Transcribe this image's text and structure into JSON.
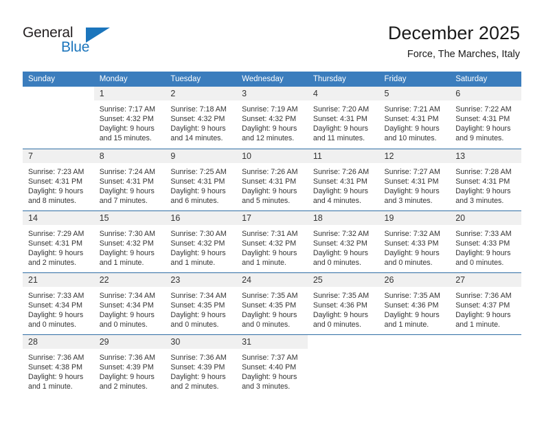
{
  "brand": {
    "line1": "General",
    "line2": "Blue",
    "triangle_color": "#1b75bc"
  },
  "header": {
    "month_title": "December 2025",
    "location": "Force, The Marches, Italy"
  },
  "theme": {
    "header_row_bg": "#3b7dbd",
    "row_divider": "#2e6da4",
    "daynum_band_bg": "#f0f0f0",
    "text": "#333333"
  },
  "calendar": {
    "weekday_headers": [
      "Sunday",
      "Monday",
      "Tuesday",
      "Wednesday",
      "Thursday",
      "Friday",
      "Saturday"
    ],
    "weeks": [
      [
        {
          "day": "",
          "blank": true,
          "lines": []
        },
        {
          "day": "1",
          "lines": [
            "Sunrise: 7:17 AM",
            "Sunset: 4:32 PM",
            "Daylight: 9 hours",
            "and 15 minutes."
          ]
        },
        {
          "day": "2",
          "lines": [
            "Sunrise: 7:18 AM",
            "Sunset: 4:32 PM",
            "Daylight: 9 hours",
            "and 14 minutes."
          ]
        },
        {
          "day": "3",
          "lines": [
            "Sunrise: 7:19 AM",
            "Sunset: 4:32 PM",
            "Daylight: 9 hours",
            "and 12 minutes."
          ]
        },
        {
          "day": "4",
          "lines": [
            "Sunrise: 7:20 AM",
            "Sunset: 4:31 PM",
            "Daylight: 9 hours",
            "and 11 minutes."
          ]
        },
        {
          "day": "5",
          "lines": [
            "Sunrise: 7:21 AM",
            "Sunset: 4:31 PM",
            "Daylight: 9 hours",
            "and 10 minutes."
          ]
        },
        {
          "day": "6",
          "lines": [
            "Sunrise: 7:22 AM",
            "Sunset: 4:31 PM",
            "Daylight: 9 hours",
            "and 9 minutes."
          ]
        }
      ],
      [
        {
          "day": "7",
          "lines": [
            "Sunrise: 7:23 AM",
            "Sunset: 4:31 PM",
            "Daylight: 9 hours",
            "and 8 minutes."
          ]
        },
        {
          "day": "8",
          "lines": [
            "Sunrise: 7:24 AM",
            "Sunset: 4:31 PM",
            "Daylight: 9 hours",
            "and 7 minutes."
          ]
        },
        {
          "day": "9",
          "lines": [
            "Sunrise: 7:25 AM",
            "Sunset: 4:31 PM",
            "Daylight: 9 hours",
            "and 6 minutes."
          ]
        },
        {
          "day": "10",
          "lines": [
            "Sunrise: 7:26 AM",
            "Sunset: 4:31 PM",
            "Daylight: 9 hours",
            "and 5 minutes."
          ]
        },
        {
          "day": "11",
          "lines": [
            "Sunrise: 7:26 AM",
            "Sunset: 4:31 PM",
            "Daylight: 9 hours",
            "and 4 minutes."
          ]
        },
        {
          "day": "12",
          "lines": [
            "Sunrise: 7:27 AM",
            "Sunset: 4:31 PM",
            "Daylight: 9 hours",
            "and 3 minutes."
          ]
        },
        {
          "day": "13",
          "lines": [
            "Sunrise: 7:28 AM",
            "Sunset: 4:31 PM",
            "Daylight: 9 hours",
            "and 3 minutes."
          ]
        }
      ],
      [
        {
          "day": "14",
          "lines": [
            "Sunrise: 7:29 AM",
            "Sunset: 4:31 PM",
            "Daylight: 9 hours",
            "and 2 minutes."
          ]
        },
        {
          "day": "15",
          "lines": [
            "Sunrise: 7:30 AM",
            "Sunset: 4:32 PM",
            "Daylight: 9 hours",
            "and 1 minute."
          ]
        },
        {
          "day": "16",
          "lines": [
            "Sunrise: 7:30 AM",
            "Sunset: 4:32 PM",
            "Daylight: 9 hours",
            "and 1 minute."
          ]
        },
        {
          "day": "17",
          "lines": [
            "Sunrise: 7:31 AM",
            "Sunset: 4:32 PM",
            "Daylight: 9 hours",
            "and 1 minute."
          ]
        },
        {
          "day": "18",
          "lines": [
            "Sunrise: 7:32 AM",
            "Sunset: 4:32 PM",
            "Daylight: 9 hours",
            "and 0 minutes."
          ]
        },
        {
          "day": "19",
          "lines": [
            "Sunrise: 7:32 AM",
            "Sunset: 4:33 PM",
            "Daylight: 9 hours",
            "and 0 minutes."
          ]
        },
        {
          "day": "20",
          "lines": [
            "Sunrise: 7:33 AM",
            "Sunset: 4:33 PM",
            "Daylight: 9 hours",
            "and 0 minutes."
          ]
        }
      ],
      [
        {
          "day": "21",
          "lines": [
            "Sunrise: 7:33 AM",
            "Sunset: 4:34 PM",
            "Daylight: 9 hours",
            "and 0 minutes."
          ]
        },
        {
          "day": "22",
          "lines": [
            "Sunrise: 7:34 AM",
            "Sunset: 4:34 PM",
            "Daylight: 9 hours",
            "and 0 minutes."
          ]
        },
        {
          "day": "23",
          "lines": [
            "Sunrise: 7:34 AM",
            "Sunset: 4:35 PM",
            "Daylight: 9 hours",
            "and 0 minutes."
          ]
        },
        {
          "day": "24",
          "lines": [
            "Sunrise: 7:35 AM",
            "Sunset: 4:35 PM",
            "Daylight: 9 hours",
            "and 0 minutes."
          ]
        },
        {
          "day": "25",
          "lines": [
            "Sunrise: 7:35 AM",
            "Sunset: 4:36 PM",
            "Daylight: 9 hours",
            "and 0 minutes."
          ]
        },
        {
          "day": "26",
          "lines": [
            "Sunrise: 7:35 AM",
            "Sunset: 4:36 PM",
            "Daylight: 9 hours",
            "and 1 minute."
          ]
        },
        {
          "day": "27",
          "lines": [
            "Sunrise: 7:36 AM",
            "Sunset: 4:37 PM",
            "Daylight: 9 hours",
            "and 1 minute."
          ]
        }
      ],
      [
        {
          "day": "28",
          "lines": [
            "Sunrise: 7:36 AM",
            "Sunset: 4:38 PM",
            "Daylight: 9 hours",
            "and 1 minute."
          ]
        },
        {
          "day": "29",
          "lines": [
            "Sunrise: 7:36 AM",
            "Sunset: 4:39 PM",
            "Daylight: 9 hours",
            "and 2 minutes."
          ]
        },
        {
          "day": "30",
          "lines": [
            "Sunrise: 7:36 AM",
            "Sunset: 4:39 PM",
            "Daylight: 9 hours",
            "and 2 minutes."
          ]
        },
        {
          "day": "31",
          "lines": [
            "Sunrise: 7:37 AM",
            "Sunset: 4:40 PM",
            "Daylight: 9 hours",
            "and 3 minutes."
          ]
        },
        {
          "day": "",
          "blank": true,
          "lines": []
        },
        {
          "day": "",
          "blank": true,
          "lines": []
        },
        {
          "day": "",
          "blank": true,
          "lines": []
        }
      ]
    ]
  }
}
